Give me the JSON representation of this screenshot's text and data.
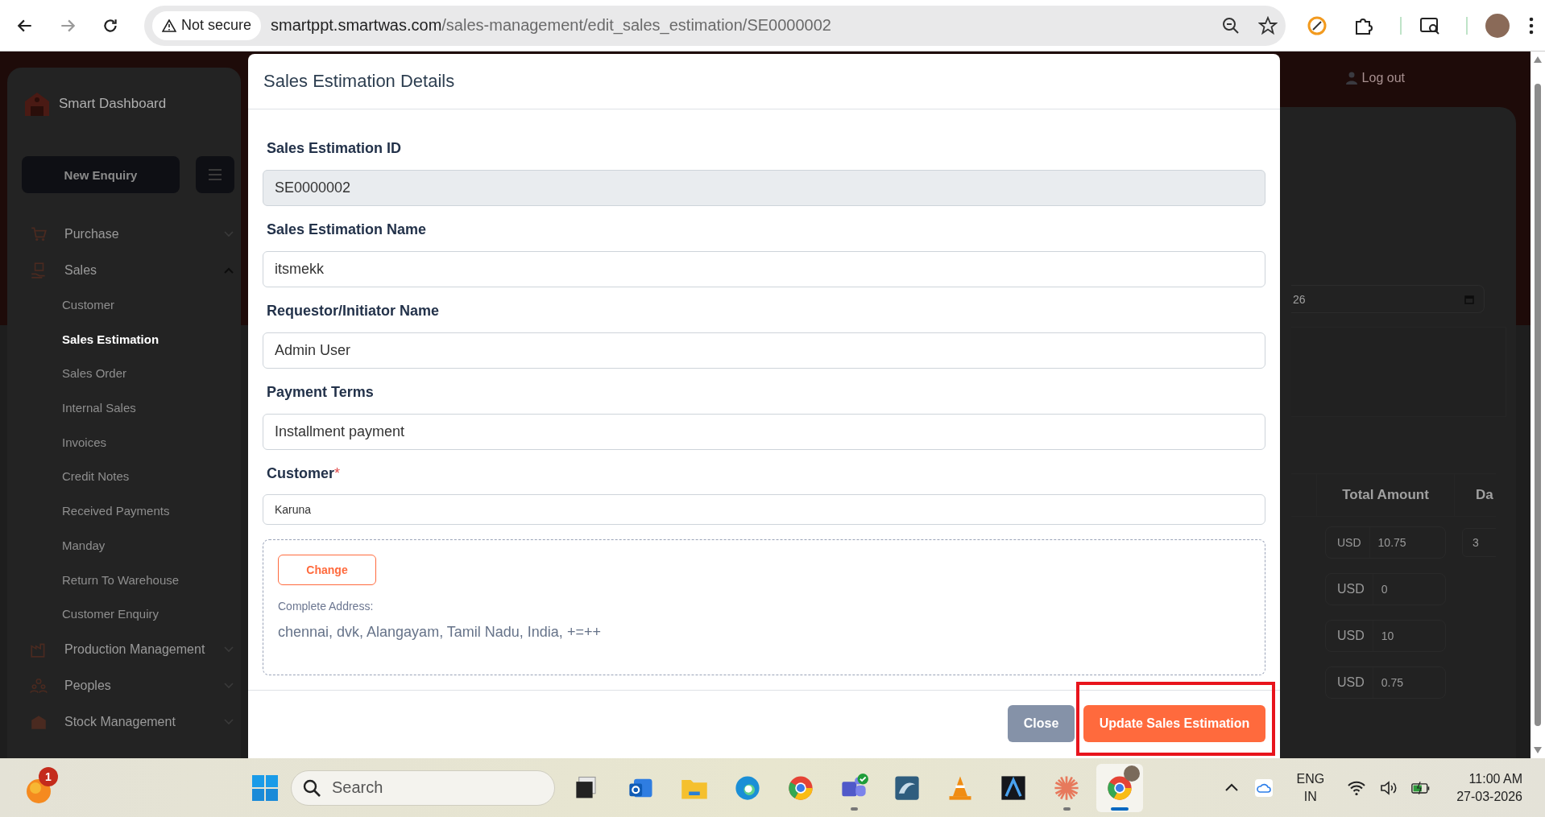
{
  "browser": {
    "nav": [
      {
        "kind": "back",
        "disabled": false
      },
      {
        "kind": "forward",
        "disabled": true
      },
      {
        "kind": "reload",
        "disabled": false
      }
    ],
    "security_label": "Not secure",
    "url_host": "smartppt.smartwas.com",
    "url_path": "/sales-management/edit_sales_estimation/SE0000002"
  },
  "page": {
    "header": {
      "logout": "Log out"
    },
    "sidebar": {
      "brand": "Smart Dashboard",
      "new_enquiry": "New Enquiry",
      "items": [
        {
          "label": "Purchase",
          "kind": "cart",
          "expanded": false
        },
        {
          "label": "Sales",
          "kind": "box-hand",
          "expanded": true,
          "children": [
            {
              "label": "Customer",
              "selected": false
            },
            {
              "label": "Sales Estimation",
              "selected": true
            },
            {
              "label": "Sales Order",
              "selected": false
            },
            {
              "label": "Internal Sales",
              "selected": false
            },
            {
              "label": "Invoices",
              "selected": false
            },
            {
              "label": "Credit Notes",
              "selected": false
            },
            {
              "label": "Received Payments",
              "selected": false
            },
            {
              "label": "Manday",
              "selected": false
            },
            {
              "label": "Return To Warehouse",
              "selected": false
            },
            {
              "label": "Customer Enquiry",
              "selected": false
            }
          ]
        },
        {
          "label": "Production Management",
          "kind": "factory",
          "expanded": false
        },
        {
          "label": "Peoples",
          "kind": "people",
          "expanded": false
        },
        {
          "label": "Stock Management",
          "kind": "warehouse",
          "expanded": false
        }
      ]
    },
    "date_field": {
      "value": "26"
    },
    "table": {
      "columns": [
        "Total Amount",
        "Da"
      ],
      "rows": [
        {
          "total_currency": "USD",
          "total": "10.75",
          "column_2": "3"
        },
        {
          "total_currency": "USD",
          "total": "0"
        },
        {
          "total_currency": "USD",
          "total": "10"
        },
        {
          "total_currency": "USD",
          "total": "0.75"
        }
      ]
    }
  },
  "modal": {
    "title": "Sales Estimation Details",
    "fields": [
      {
        "label": "Sales Estimation ID",
        "value": "SE0000002",
        "readonly": true
      },
      {
        "label": "Sales Estimation Name",
        "value": "itsmekk",
        "readonly": false
      },
      {
        "label": "Requestor/Initiator Name",
        "value": "Admin User",
        "readonly": false
      },
      {
        "label": "Payment Terms",
        "value": "Installment payment",
        "readonly": false
      }
    ],
    "customer": {
      "label": "Customer",
      "required_mark": "*",
      "value": "Karuna"
    },
    "address": {
      "change_button": "Change",
      "label": "Complete Address:",
      "text": "chennai, dvk, Alangayam, Tamil Nadu, India, +=++"
    },
    "buttons": {
      "close": "Close",
      "update": "Update Sales Estimation"
    }
  },
  "taskbar": {
    "notification_badge": "1",
    "search_placeholder": "Search",
    "apps": [
      {
        "kind": "window-stack",
        "running": false,
        "selected": false
      },
      {
        "kind": "mail",
        "running": false,
        "selected": false
      },
      {
        "kind": "folder",
        "running": false,
        "selected": false
      },
      {
        "kind": "edge",
        "running": false,
        "selected": false
      },
      {
        "kind": "chrome",
        "running": false,
        "selected": false
      },
      {
        "kind": "teams",
        "running": true,
        "selected": false
      },
      {
        "kind": "dolphin",
        "running": false,
        "selected": false
      },
      {
        "kind": "cone",
        "running": false,
        "selected": false
      },
      {
        "kind": "arch",
        "running": false,
        "selected": false
      },
      {
        "kind": "burst",
        "running": true,
        "selected": false
      },
      {
        "kind": "chrome-profile",
        "running": true,
        "selected": true
      }
    ],
    "language": "ENG",
    "region": "IN",
    "time": "11:00 AM",
    "date": "27-03-2026"
  }
}
